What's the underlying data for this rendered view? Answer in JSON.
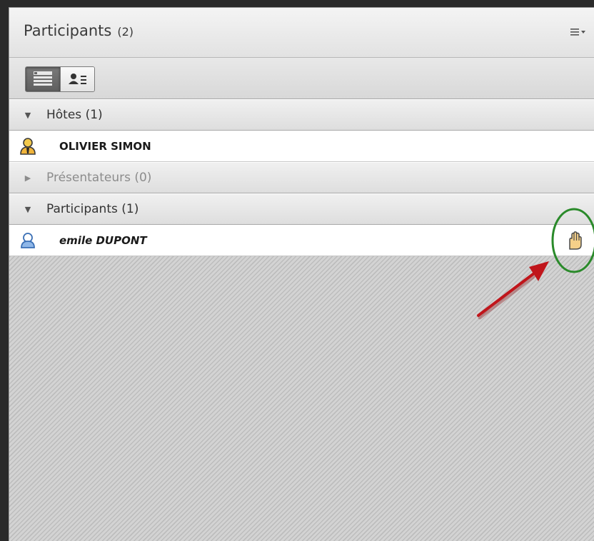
{
  "pod": {
    "title": "Participants",
    "count": "(2)",
    "menu_icon": "options-menu-icon"
  },
  "toolbar": {
    "views": [
      {
        "name": "list-view-icon",
        "active": true
      },
      {
        "name": "attendee-view-icon",
        "active": false
      }
    ]
  },
  "sections": {
    "hosts": {
      "label": "Hôtes (1)",
      "expanded": true
    },
    "presenters": {
      "label": "Présentateurs (0)",
      "expanded": false
    },
    "participants": {
      "label": "Participants (1)",
      "expanded": true
    }
  },
  "attendees": [
    {
      "name": "OLIVIER SIMON",
      "role": "host",
      "icon": "host-user-icon"
    },
    {
      "name": "emile DUPONT",
      "role": "participant",
      "icon": "participant-user-icon",
      "status_icon": "raised-hand-icon"
    }
  ],
  "colors": {
    "annotation_circle": "#2a8a2a",
    "annotation_arrow": "#c0151b"
  }
}
